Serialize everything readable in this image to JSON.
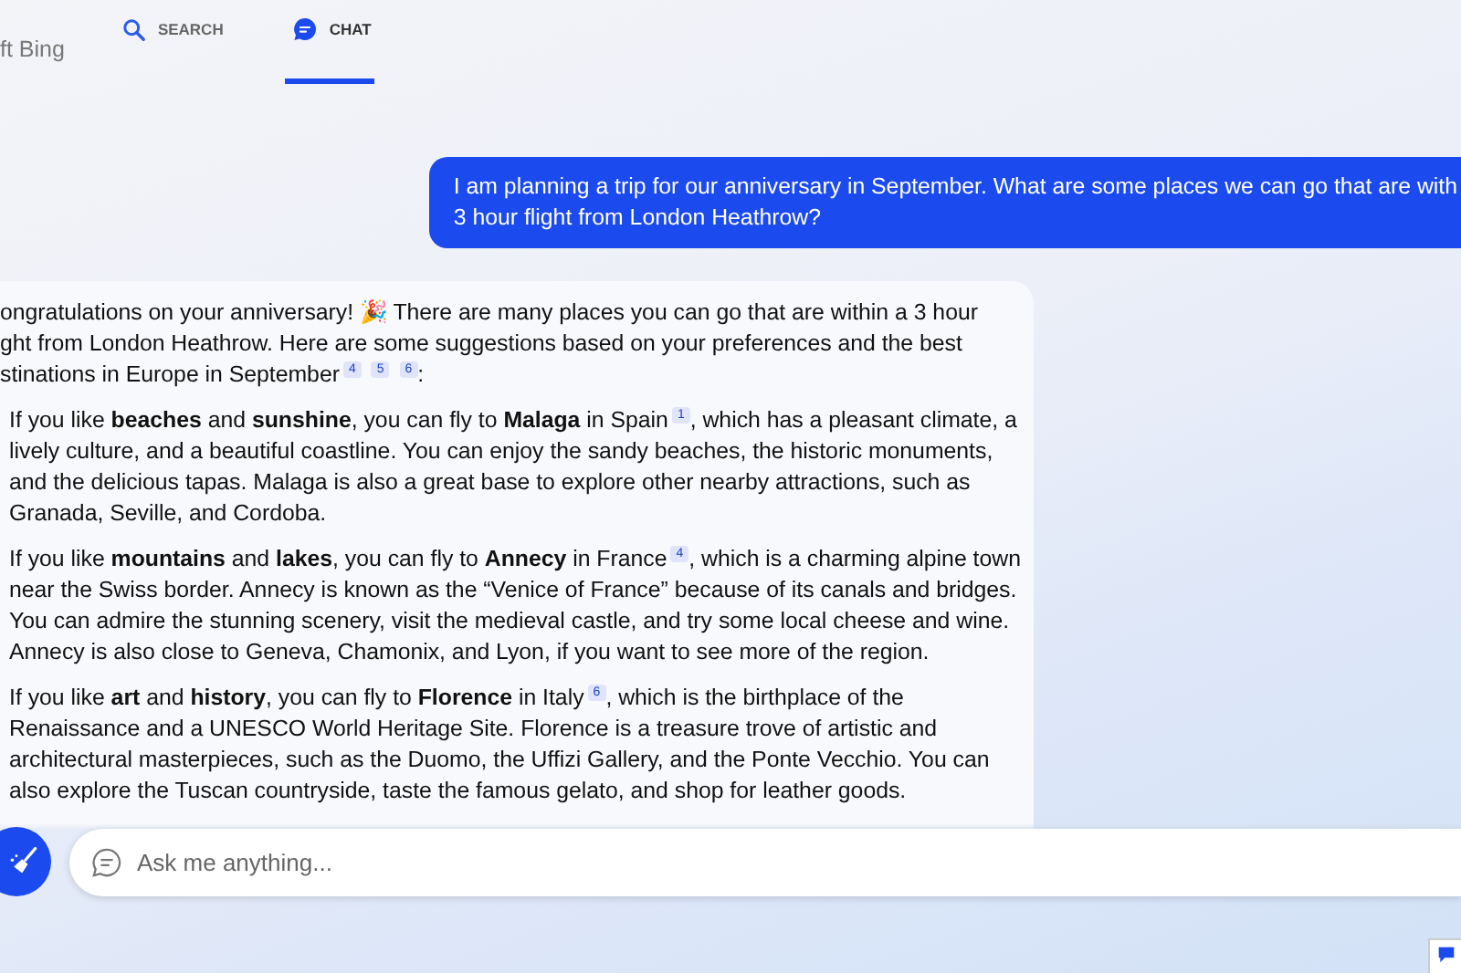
{
  "brand": "ft Bing",
  "tabs": [
    {
      "label": "SEARCH",
      "selected": false,
      "kind": "search"
    },
    {
      "label": "CHAT",
      "selected": true,
      "kind": "chat"
    }
  ],
  "user_message": {
    "lines": [
      "I am planning a trip for our anniversary in September. What are some places we can go that are with",
      "3 hour flight from London Heathrow?"
    ]
  },
  "response": {
    "intro": [
      "ongratulations on your anniversary! 🎉 There are many places you can go that are within a 3 hour",
      "ght from London Heathrow. Here are some suggestions based on your preferences and the best",
      "stinations in Europe in September$^{4}$ $^{5}$ $^{6}$:"
    ],
    "items": [
      {
        "lines": [
          "If you like **beaches** and **sunshine**, you can fly to **Malaga** in Spain$^{1}$, which has a pleasant climate, a",
          "lively culture, and a beautiful coastline. You can enjoy the sandy beaches, the historic monuments,",
          "and the delicious tapas. Malaga is also a great base to explore other nearby attractions, such as",
          "Granada, Seville, and Cordoba."
        ]
      },
      {
        "lines": [
          "If you like **mountains** and **lakes**, you can fly to **Annecy** in France$^{4}$, which is a charming alpine town",
          "near the Swiss border. Annecy is known as the “Venice of France” because of its canals and bridges.",
          "You can admire the stunning scenery, visit the medieval castle, and try some local cheese and wine.",
          "Annecy is also close to Geneva, Chamonix, and Lyon, if you want to see more of the region."
        ]
      },
      {
        "lines": [
          "If you like **art** and **history**, you can fly to **Florence** in Italy$^{6}$, which is the birthplace of the",
          "Renaissance and a UNESCO World Heritage Site. Florence is a treasure trove of artistic and",
          "architectural masterpieces, such as the Duomo, the Uffizi Gallery, and the Ponte Vecchio. You can",
          "also explore the Tuscan countryside, taste the famous gelato, and shop for leather goods."
        ]
      }
    ]
  },
  "composer": {
    "placeholder": "Ask me anything..."
  }
}
